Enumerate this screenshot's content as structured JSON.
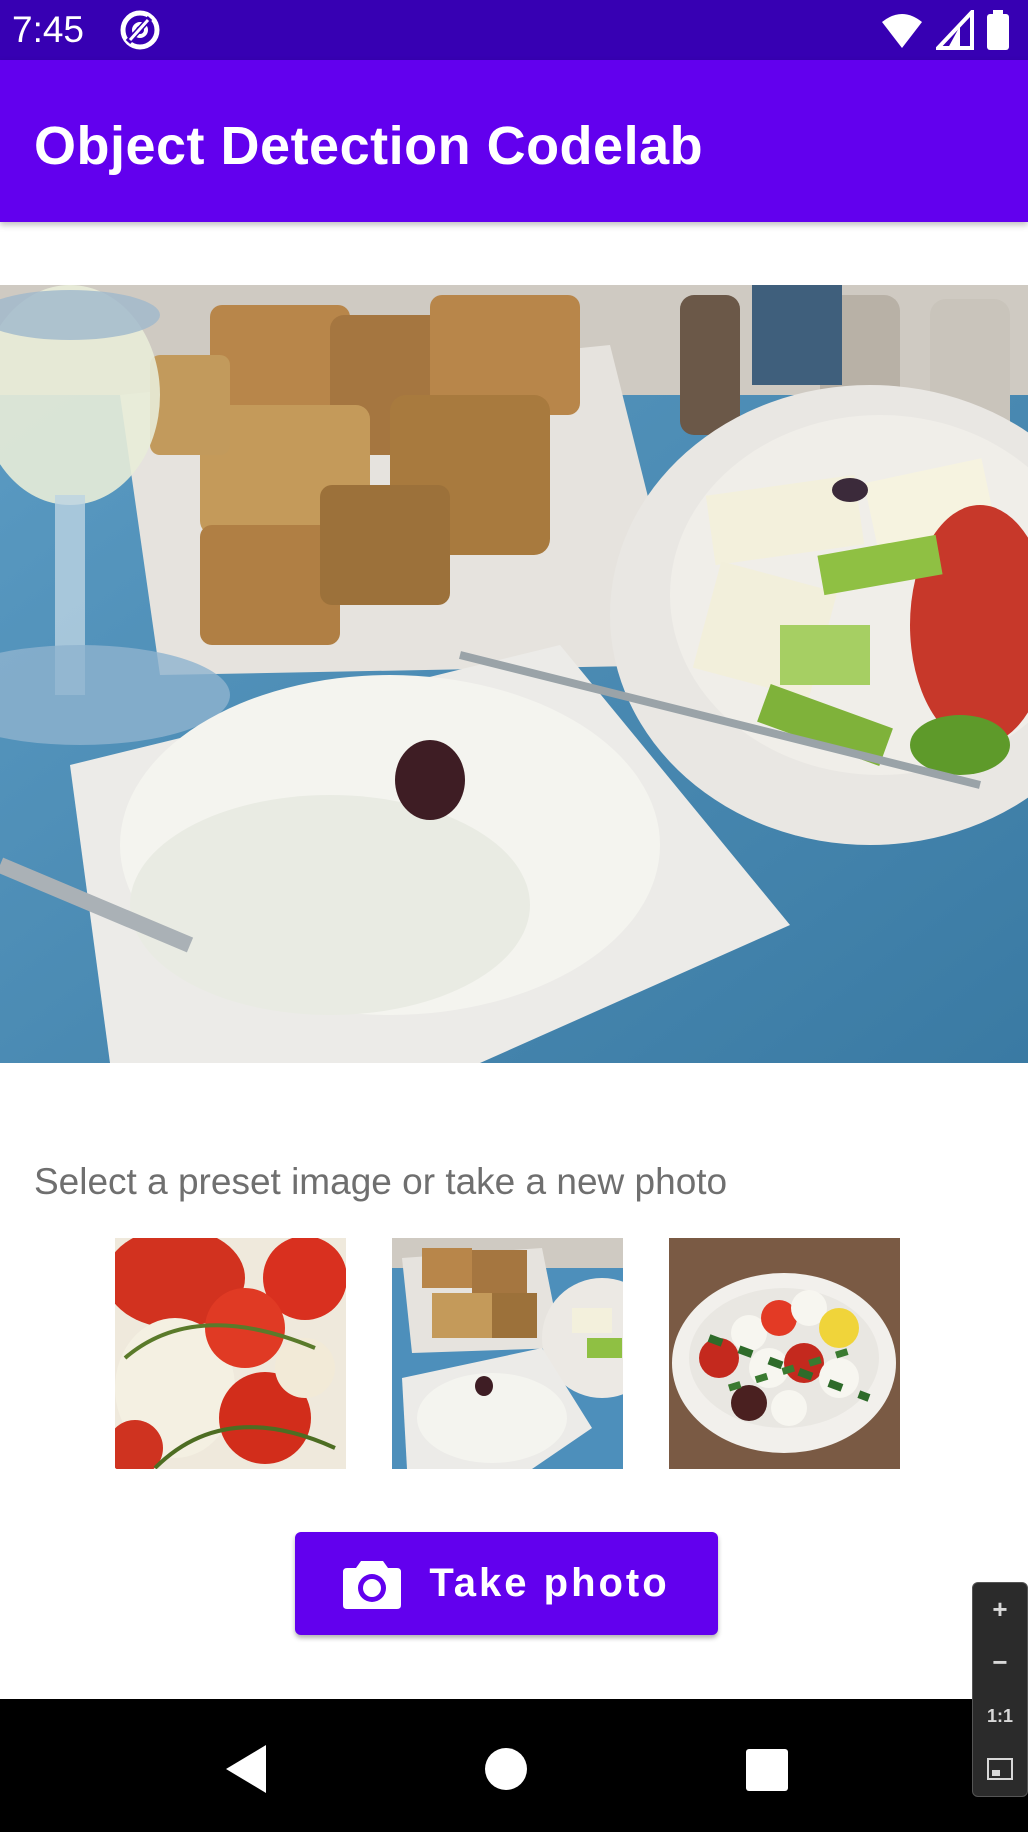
{
  "status_bar": {
    "time": "7:45",
    "icons": [
      "app-notification-icon",
      "wifi-icon",
      "signal-icon",
      "battery-icon"
    ]
  },
  "app_bar": {
    "title": "Object Detection Codelab",
    "color": "#6200ee"
  },
  "main_image": {
    "subject": "greek-food-table-photo"
  },
  "instruction_text": "Select a preset image or take a new photo",
  "presets": [
    {
      "subject": "tomatoes-and-onion"
    },
    {
      "subject": "greek-food-table"
    },
    {
      "subject": "caprese-salad"
    }
  ],
  "take_photo_button": {
    "label": "Take photo",
    "icon": "camera-icon"
  },
  "nav_bar": {
    "buttons": [
      "back-icon",
      "home-icon",
      "recents-icon"
    ]
  },
  "zoom_controls": {
    "plus": "+",
    "minus": "−",
    "one_to_one": "1:1",
    "icons": [
      "zoom-in-icon",
      "zoom-out-icon",
      "actual-size-icon",
      "fit-screen-icon"
    ]
  },
  "colors": {
    "status_bar": "#3700b3",
    "primary": "#6200ee",
    "instruction_text": "#6f6f6f"
  }
}
